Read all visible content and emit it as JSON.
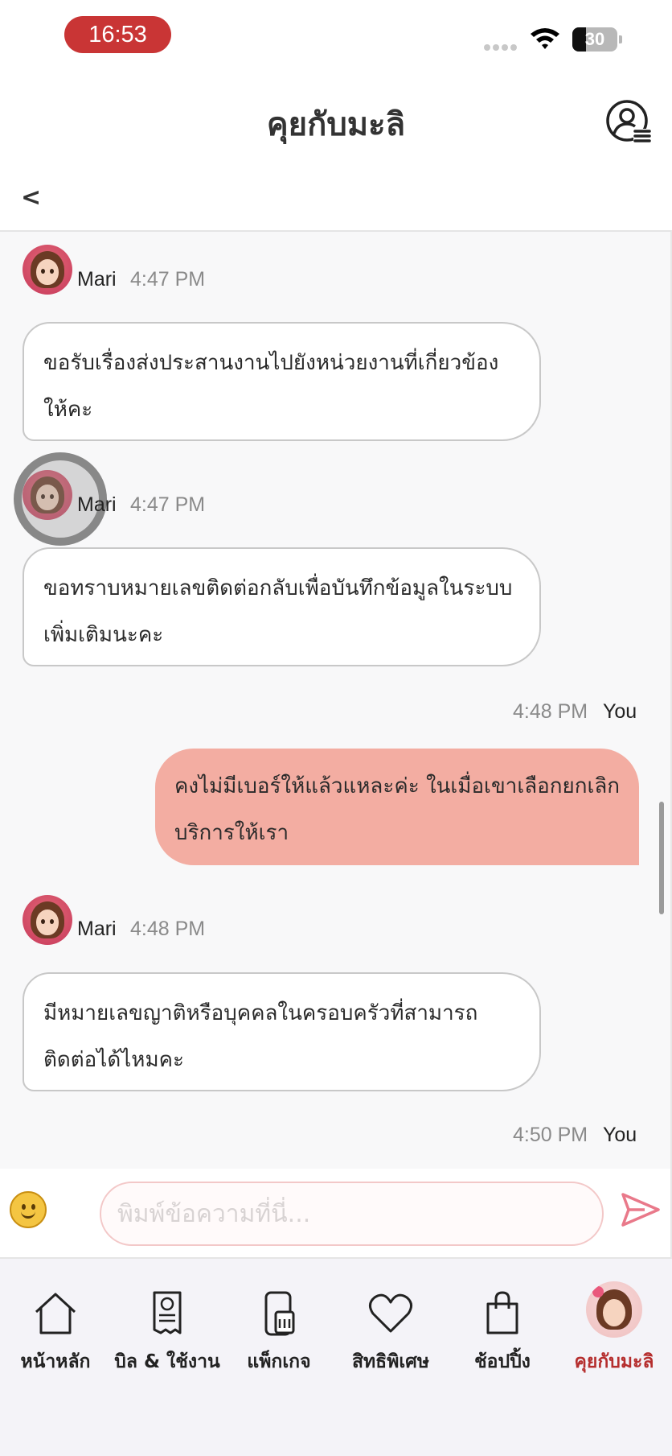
{
  "status_bar": {
    "time": "16:53",
    "battery": "30",
    "battery_level": 0.3
  },
  "header": {
    "title": "คุยกับมะลิ",
    "back_label": "<"
  },
  "messages": [
    {
      "sender": "Mari",
      "time": "4:47 PM",
      "line1": "ขอรับเรื่องส่งประสานงานไปยังหน่วยงานที่เกี่ยวข้อง",
      "line2": "ให้คะ"
    },
    {
      "sender": "Mari",
      "time": "4:47 PM",
      "line1": "ขอทราบหมายเลขติดต่อกลับเพื่อบันทึกข้อมูลในระบบ",
      "line2": "เพิ่มเติมนะคะ"
    },
    {
      "sender": "You",
      "time": "4:48 PM",
      "line1": "คงไม่มีเบอร์ให้แล้วแหละค่ะ ในเมื่อเขาเลือกยกเลิก",
      "line2": "บริการให้เรา"
    },
    {
      "sender": "Mari",
      "time": "4:48 PM",
      "line1": "มีหมายเลขญาติหรือบุคคลในครอบครัวที่สามารถ",
      "line2": "ติดต่อได้ไหมคะ"
    },
    {
      "sender": "You",
      "time": "4:50 PM"
    }
  ],
  "input": {
    "placeholder": "พิมพ์ข้อความที่นี่..."
  },
  "nav": [
    {
      "label": "หน้าหลัก",
      "icon": "home-icon"
    },
    {
      "label": "บิล & ใช้งาน",
      "icon": "bill-icon"
    },
    {
      "label": "แพ็กเกจ",
      "icon": "package-icon"
    },
    {
      "label": "สิทธิพิเศษ",
      "icon": "heart-icon"
    },
    {
      "label": "ช้อปปิ้ง",
      "icon": "shopping-bag-icon"
    },
    {
      "label": "คุยกับมะลิ",
      "icon": "mali-avatar-icon",
      "active": true
    }
  ],
  "colors": {
    "accent": "#b52e2e",
    "user_bubble": "#f3ada2",
    "time_pill": "#c93535"
  }
}
